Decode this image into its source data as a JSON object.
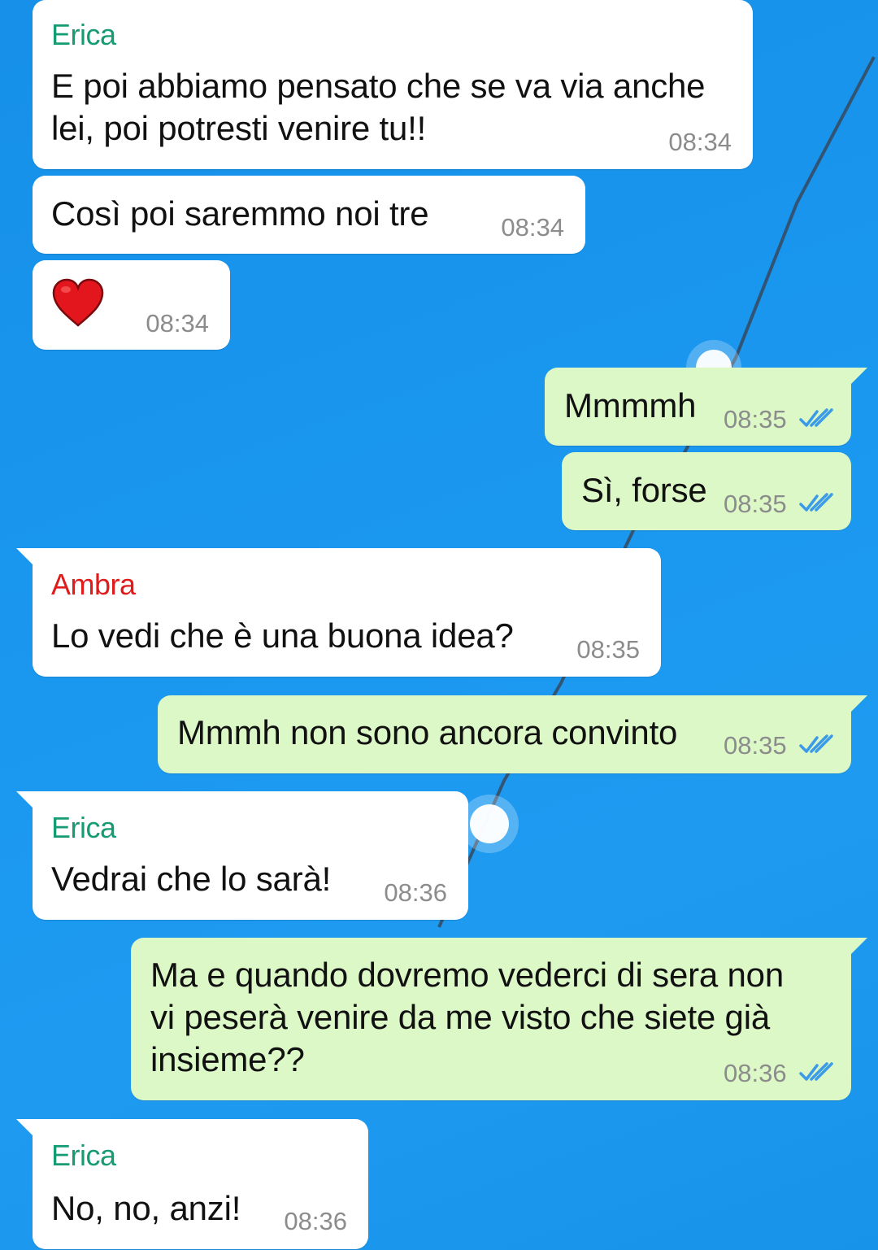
{
  "colors": {
    "background": "#1a97ef",
    "incoming_bubble": "#ffffff",
    "outgoing_bubble": "#dcf8c6",
    "sender_erica": "#179b74",
    "sender_ambra": "#e01b1b",
    "read_ticks": "#3b9be8",
    "timestamp": "#8c8c8c"
  },
  "messages": [
    {
      "id": 1,
      "direction": "incoming",
      "sender": "Erica",
      "text": "E poi abbiamo pensato che se va via anche\nlei, poi potresti venire tu!!",
      "time": "08:34"
    },
    {
      "id": 2,
      "direction": "incoming",
      "sender": "",
      "text": "Così poi saremmo noi tre",
      "time": "08:34"
    },
    {
      "id": 3,
      "direction": "incoming",
      "sender": "",
      "emoji": "heart-emoji",
      "time": "08:34"
    },
    {
      "id": 4,
      "direction": "outgoing",
      "text": "Mmmmh",
      "time": "08:35",
      "status": "read-ticks-icon"
    },
    {
      "id": 5,
      "direction": "outgoing",
      "text": "Sì, forse",
      "time": "08:35",
      "status": "read-ticks-icon"
    },
    {
      "id": 6,
      "direction": "incoming",
      "sender": "Ambra",
      "text": "Lo vedi che è una buona idea?",
      "time": "08:35"
    },
    {
      "id": 7,
      "direction": "outgoing",
      "text": "Mmmh non sono ancora convinto",
      "time": "08:35",
      "status": "read-ticks-icon"
    },
    {
      "id": 8,
      "direction": "incoming",
      "sender": "Erica",
      "text": "Vedrai che lo sarà!",
      "time": "08:36"
    },
    {
      "id": 9,
      "direction": "outgoing",
      "text": "Ma e quando dovremo vederci di sera non\nvi peserà venire da me visto che siete già\ninsieme??",
      "time": "08:36",
      "status": "read-ticks-icon"
    },
    {
      "id": 10,
      "direction": "incoming",
      "sender": "Erica",
      "text": "No, no, anzi!",
      "time": "08:36"
    }
  ]
}
